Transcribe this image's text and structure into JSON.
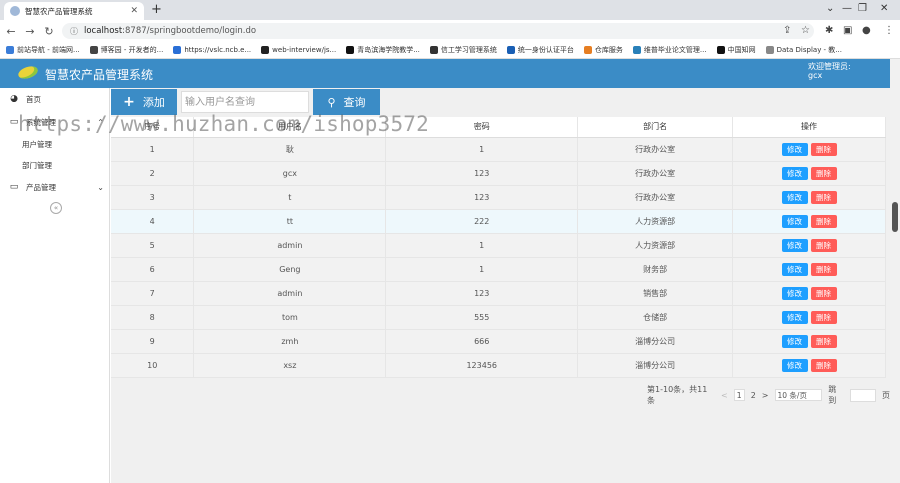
{
  "browser": {
    "tab_title": "智慧农产品管理系统",
    "url_host": "localhost",
    "url_rest": ":8787/springbootdemo/login.do",
    "bookmarks": [
      {
        "label": "前站导航 - 前端网...",
        "color": "#3b7dd8"
      },
      {
        "label": "博客园 - 开发者的...",
        "color": "#444444"
      },
      {
        "label": "https://vslc.ncb.e...",
        "color": "#2a6fd6"
      },
      {
        "label": "web-interview/js...",
        "color": "#222222"
      },
      {
        "label": "青岛滨海学院教学...",
        "color": "#111111"
      },
      {
        "label": "信工学习管理系统",
        "color": "#333333"
      },
      {
        "label": "统一身份认证平台",
        "color": "#1a5fb4"
      },
      {
        "label": "仓库服务",
        "color": "#e67e22"
      },
      {
        "label": "维普毕业论文管理...",
        "color": "#2980b9"
      },
      {
        "label": "中国知网",
        "color": "#111111"
      },
      {
        "label": "Data Display - 教...",
        "color": "#888888"
      }
    ]
  },
  "app": {
    "title": "智慧农产品管理系统",
    "welcome_line1": "欢迎管理员:",
    "welcome_line2": "gcx"
  },
  "sidebar": {
    "items": [
      {
        "label": "首页",
        "icon": "dashboard-icon"
      },
      {
        "label": "系统管理",
        "icon": "monitor-icon"
      },
      {
        "label": "用户管理"
      },
      {
        "label": "部门管理"
      },
      {
        "label": "产品管理",
        "icon": "monitor-icon"
      }
    ]
  },
  "toolbar": {
    "add_label": "添加",
    "search_placeholder": "输入用户名查询",
    "query_label": "查询"
  },
  "table": {
    "headers": [
      "序号",
      "用户名",
      "密码",
      "部门名",
      "操作"
    ],
    "edit_label": "修改",
    "delete_label": "删除",
    "rows": [
      [
        "1",
        "耿",
        "1",
        "行政办公室"
      ],
      [
        "2",
        "gcx",
        "123",
        "行政办公室"
      ],
      [
        "3",
        "t",
        "123",
        "行政办公室"
      ],
      [
        "4",
        "tt",
        "222",
        "人力资源部"
      ],
      [
        "5",
        "admin",
        "1",
        "人力资源部"
      ],
      [
        "6",
        "Geng",
        "1",
        "财务部"
      ],
      [
        "7",
        "admin",
        "123",
        "销售部"
      ],
      [
        "8",
        "tom",
        "555",
        "仓储部"
      ],
      [
        "9",
        "zmh",
        "666",
        "淄博分公司"
      ],
      [
        "10",
        "xsz",
        "123456",
        "淄博分公司"
      ]
    ]
  },
  "pager": {
    "summary": "第1-10条，共11条",
    "prev": "<",
    "page1": "1",
    "page2": "2",
    "next": ">",
    "page_size": "10 条/页",
    "jump_label": "跳到",
    "page_unit": "页"
  },
  "watermark": "https://www.huzhan.com/ishop3572",
  "colors": {
    "accent": "#3b8cc6",
    "edit": "#1e9fff",
    "delete": "#ff5c58"
  }
}
